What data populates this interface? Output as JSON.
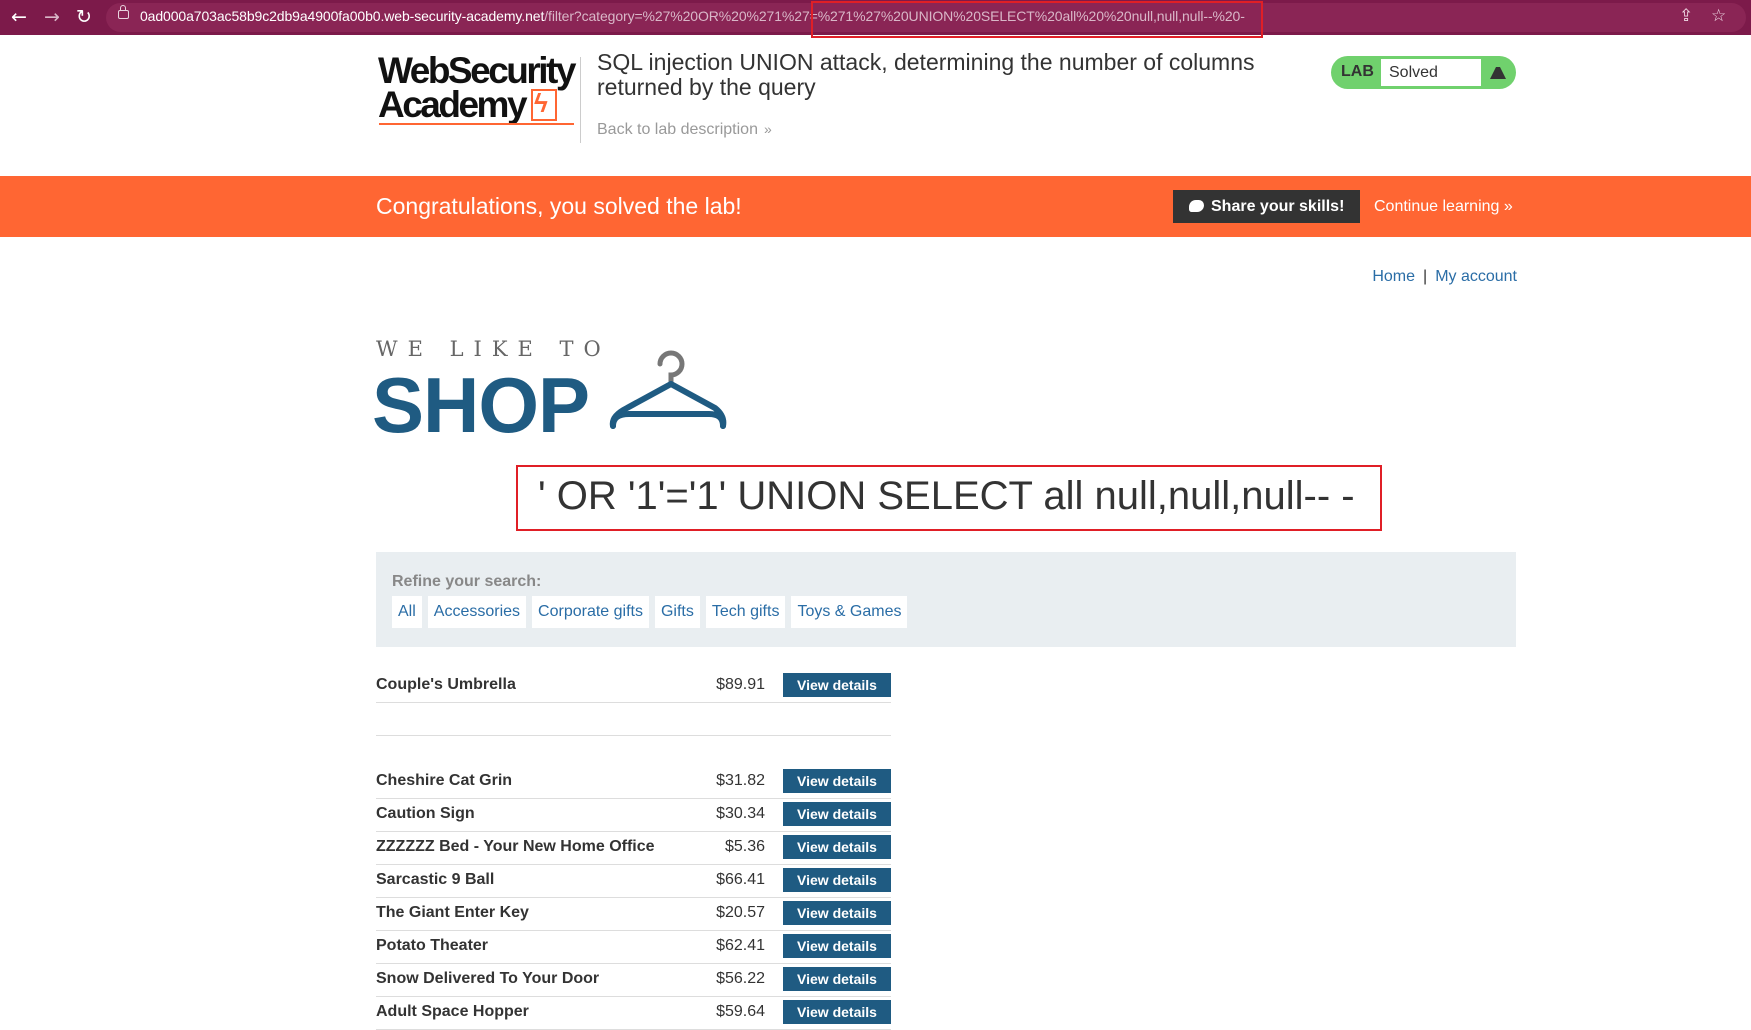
{
  "browser": {
    "url_host": "0ad000a703ac58b9c2db9a4900fa00b0.web-security-academy.net",
    "url_path": "/filter?category=%27%20OR%20%271%27=%271%27%20UNION%20SELECT%20all%20%20null,null,null--%20-",
    "back_icon": "←",
    "forward_icon": "→",
    "reload_icon": "↻",
    "share_icon": "⇪",
    "star_icon": "☆"
  },
  "header": {
    "logo_line1": "WebSecurity",
    "logo_line2": "Academy",
    "lab_title": "SQL injection UNION attack, determining the number of columns returned by the query",
    "back_link": "Back to lab description",
    "back_chevron": "»",
    "lab_badge": "LAB",
    "lab_status": "Solved"
  },
  "banner": {
    "message": "Congratulations, you solved the lab!",
    "share_button": "Share your skills!",
    "continue_link": "Continue learning",
    "continue_chevron": "»"
  },
  "nav": {
    "home": "Home",
    "separator": "|",
    "my_account": "My account"
  },
  "shop_logo": {
    "tagline": "WE LIKE TO",
    "word": "SHOP"
  },
  "query_heading": "' OR '1'='1' UNION SELECT all null,null,null-- -",
  "filter": {
    "label": "Refine your search:",
    "categories": [
      "All",
      "Accessories",
      "Corporate gifts",
      "Gifts",
      "Tech gifts",
      "Toys & Games"
    ]
  },
  "view_details_label": "View details",
  "products": [
    {
      "name": "Couple's Umbrella",
      "price": "$89.91"
    },
    {
      "name": "",
      "price": ""
    },
    {
      "name": "Cheshire Cat Grin",
      "price": "$31.82"
    },
    {
      "name": "Caution Sign",
      "price": "$30.34"
    },
    {
      "name": "ZZZZZZ Bed - Your New Home Office",
      "price": "$5.36"
    },
    {
      "name": "Sarcastic 9 Ball",
      "price": "$66.41"
    },
    {
      "name": "The Giant Enter Key",
      "price": "$20.57"
    },
    {
      "name": "Potato Theater",
      "price": "$62.41"
    },
    {
      "name": "Snow Delivered To Your Door",
      "price": "$56.22"
    },
    {
      "name": "Adult Space Hopper",
      "price": "$59.64"
    }
  ],
  "colors": {
    "chrome": "#7c1a4a",
    "banner": "#ff6633",
    "brand_blue": "#1f5b82",
    "link_blue": "#2a6da6",
    "lab_green": "#70d16d",
    "highlight_red": "#e01f26"
  }
}
